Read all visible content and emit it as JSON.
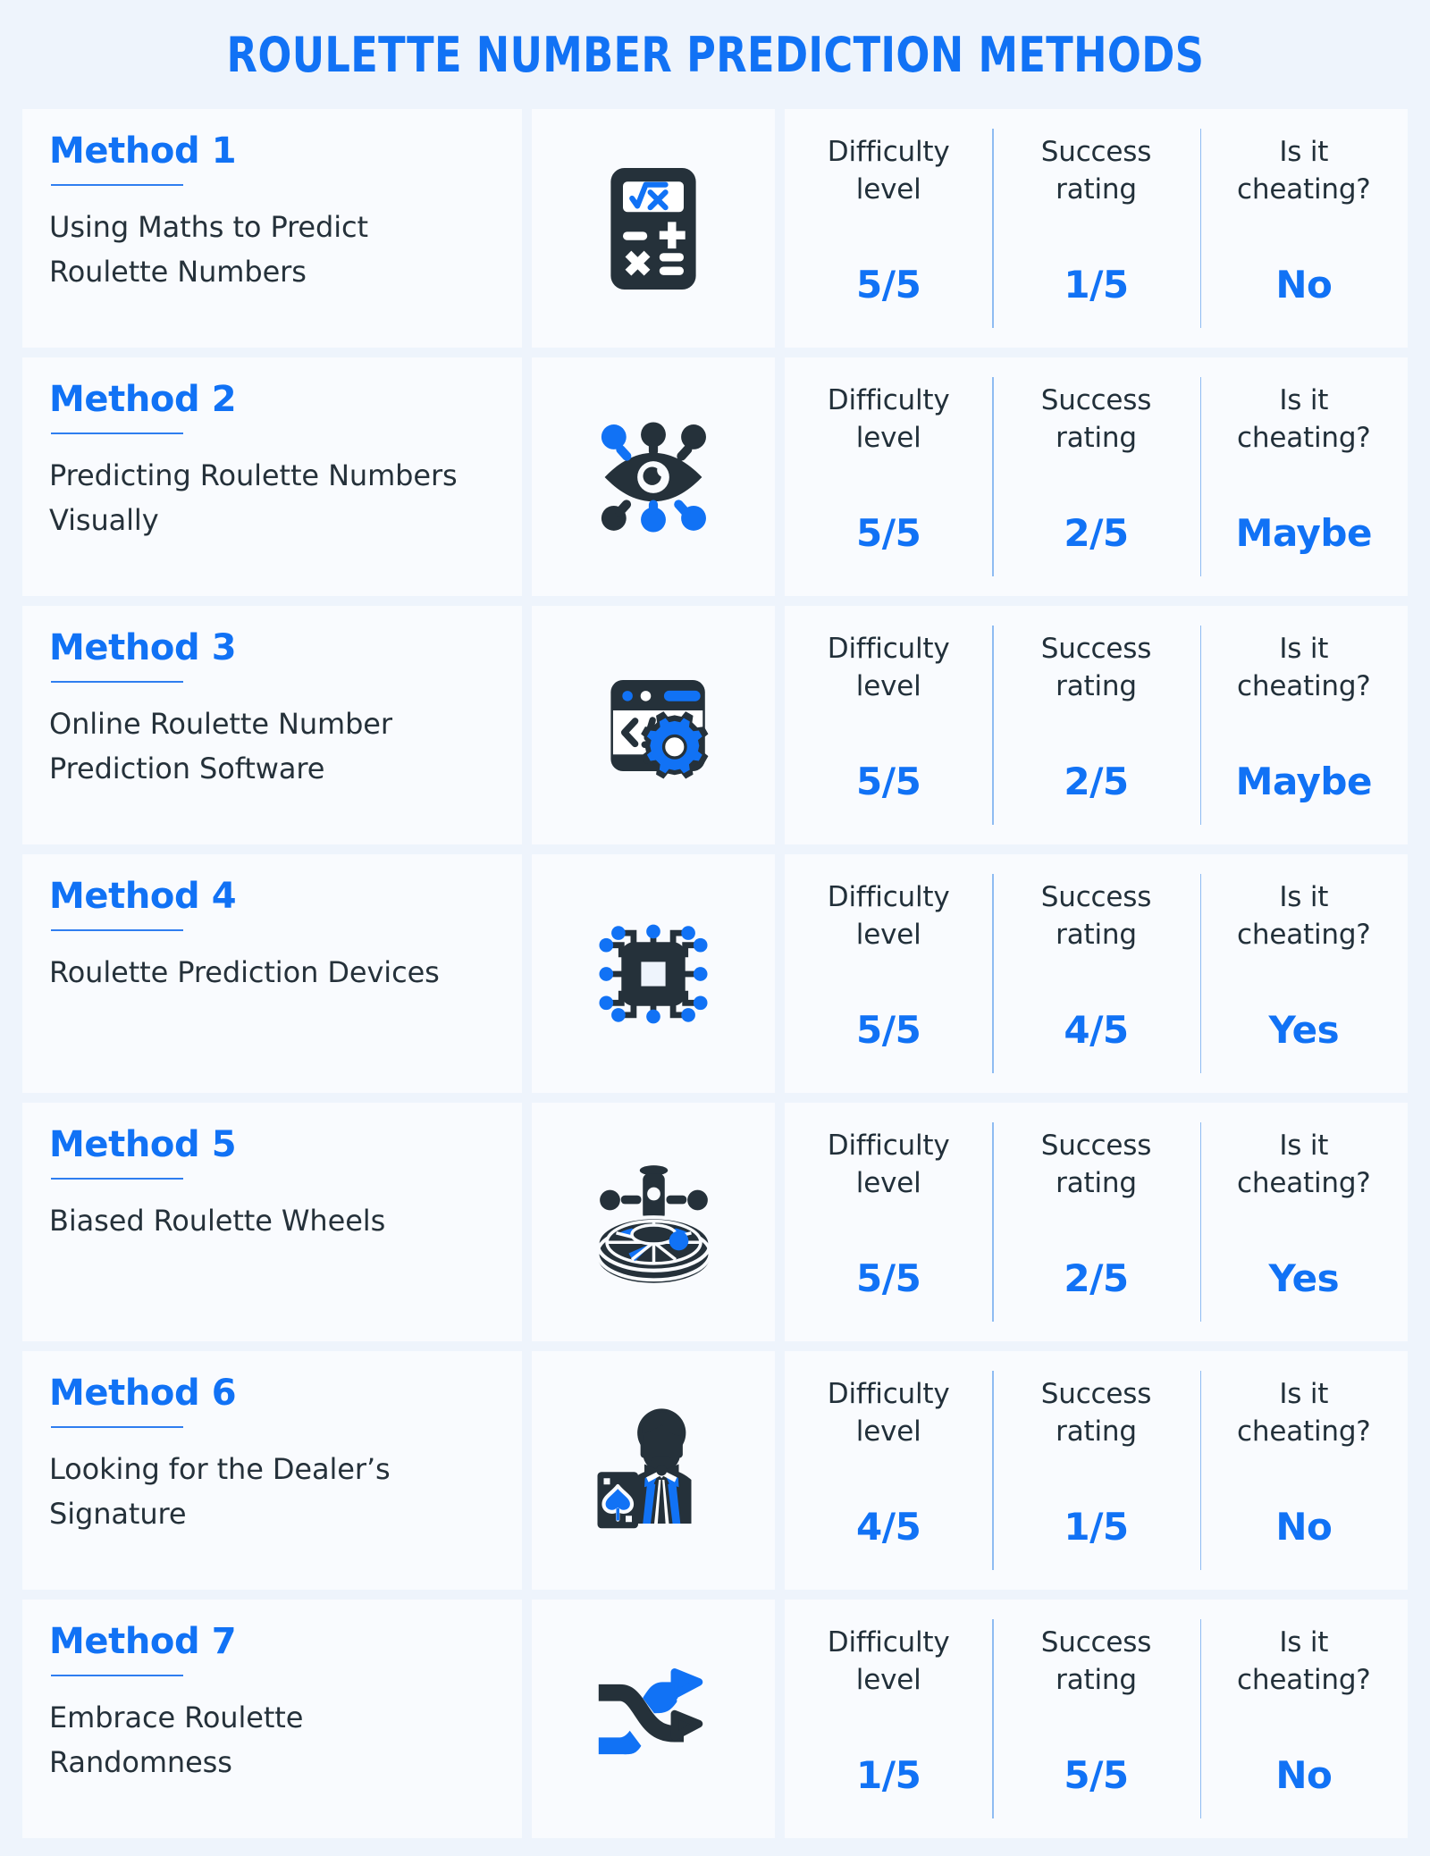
{
  "header": {
    "title": "ROULETTE NUMBER PREDICTION METHODS"
  },
  "colors": {
    "accent_blue": "#1172f5",
    "icon_blue": "#1172f5",
    "icon_dark": "#25313a",
    "page_background": "#eef4fc",
    "card_background": "#f9fbfe",
    "divider": "#8fbcf2",
    "body_text": "#25313a"
  },
  "stat_headers": {
    "difficulty": "Difficulty level",
    "success": "Success rating",
    "cheating": "Is it cheating?"
  },
  "rows": [
    {
      "method_label": "Method 1",
      "description": "Using Maths to Predict Roulette Numbers",
      "icon_name": "calculator-icon",
      "difficulty_head": "Difficulty level",
      "success_head": "Success rating",
      "cheating_head": "Is it cheating?",
      "difficulty": "5/5",
      "success": "1/5",
      "cheating": "No"
    },
    {
      "method_label": "Method 2",
      "description": "Predicting Roulette Numbers Visually",
      "icon_name": "eye-network-icon",
      "difficulty_head": "Difficulty level",
      "success_head": "Success rating",
      "cheating_head": "Is it cheating?",
      "difficulty": "5/5",
      "success": "2/5",
      "cheating": "Maybe"
    },
    {
      "method_label": "Method 3",
      "description": "Online Roulette Number Prediction Software",
      "icon_name": "code-window-gear-icon",
      "difficulty_head": "Difficulty level",
      "success_head": "Success rating",
      "cheating_head": "Is it cheating?",
      "difficulty": "5/5",
      "success": "2/5",
      "cheating": "Maybe"
    },
    {
      "method_label": "Method 4",
      "description": "Roulette Prediction Devices",
      "icon_name": "microchip-icon",
      "difficulty_head": "Difficulty level",
      "success_head": "Success rating",
      "cheating_head": "Is it cheating?",
      "difficulty": "5/5",
      "success": "4/5",
      "cheating": "Yes"
    },
    {
      "method_label": "Method 5",
      "description": "Biased Roulette Wheels",
      "icon_name": "roulette-wheel-icon",
      "difficulty_head": "Difficulty level",
      "success_head": "Success rating",
      "cheating_head": "Is it cheating?",
      "difficulty": "5/5",
      "success": "2/5",
      "cheating": "Yes"
    },
    {
      "method_label": "Method 6",
      "description": "Looking for the Dealer’s Signature",
      "icon_name": "dealer-icon",
      "difficulty_head": "Difficulty level",
      "success_head": "Success rating",
      "cheating_head": "Is it cheating?",
      "difficulty": "4/5",
      "success": "1/5",
      "cheating": "No"
    },
    {
      "method_label": "Method 7",
      "description": "Embrace Roulette Randomness",
      "icon_name": "shuffle-arrows-icon",
      "difficulty_head": "Difficulty level",
      "success_head": "Success rating",
      "cheating_head": "Is it cheating?",
      "difficulty": "1/5",
      "success": "5/5",
      "cheating": "No"
    }
  ]
}
